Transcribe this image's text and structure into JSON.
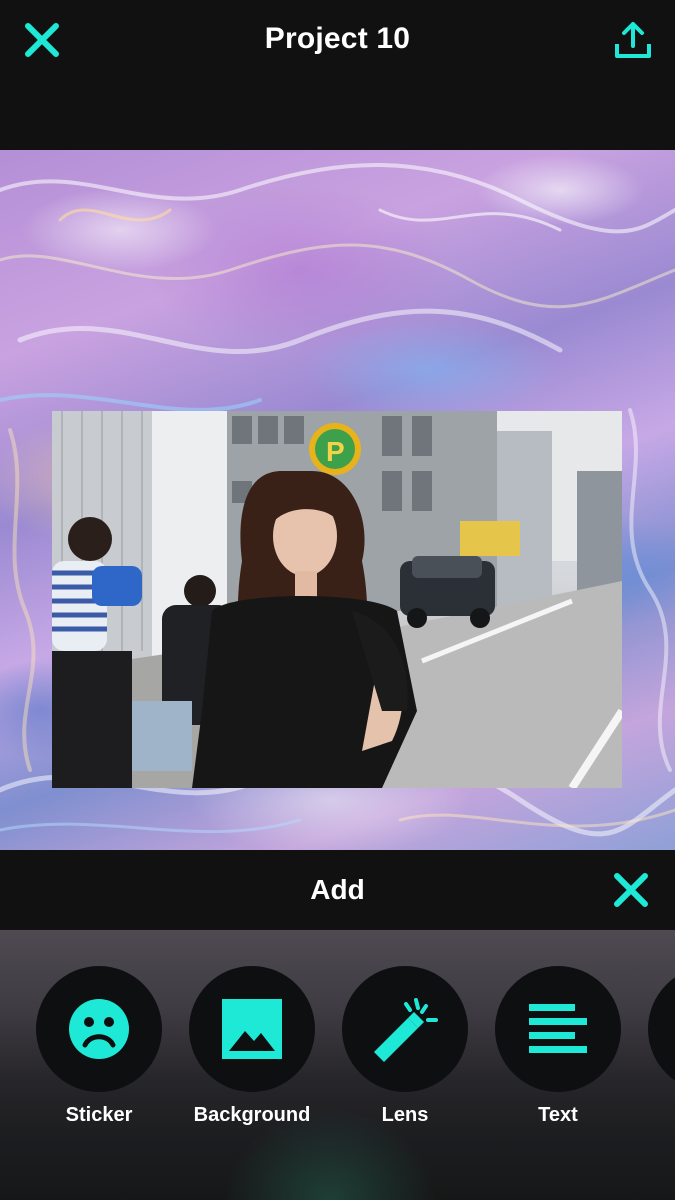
{
  "header": {
    "title": "Project 10",
    "close_icon": "close-icon",
    "share_icon": "share-upload-icon"
  },
  "canvas": {
    "background": "holographic-texture",
    "photo": "street-portrait-photo"
  },
  "add_panel": {
    "title": "Add",
    "close_icon": "close-icon",
    "tools": [
      {
        "label": "Sticker",
        "icon": "sad-face-icon"
      },
      {
        "label": "Background",
        "icon": "image-icon"
      },
      {
        "label": "Lens",
        "icon": "magic-wand-icon"
      },
      {
        "label": "Text",
        "icon": "text-align-icon"
      }
    ]
  },
  "colors": {
    "accent": "#1de9d6",
    "bar_background": "#111111",
    "tool_circle": "#0e0f10",
    "text": "#ffffff"
  }
}
